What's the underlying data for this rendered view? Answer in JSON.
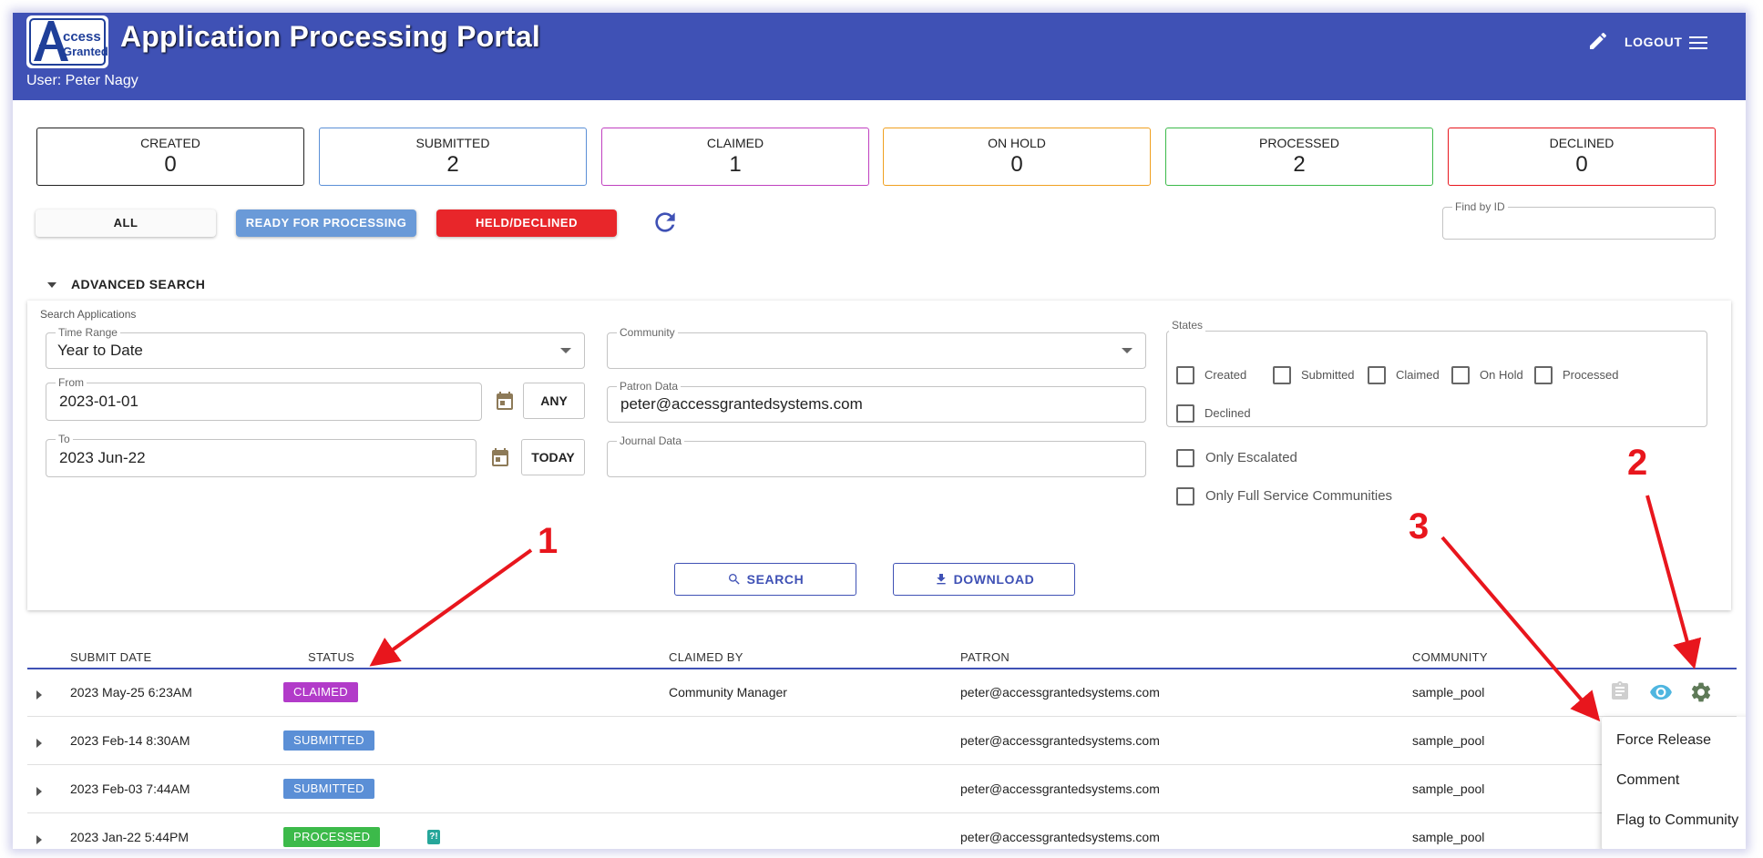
{
  "header": {
    "logo_line1": "ccess",
    "logo_line2": "Granted",
    "title": "Application Processing Portal",
    "user": "User: Peter Nagy",
    "logout_label": "LOGOUT",
    "bar_color": "#3f51b5"
  },
  "status_counts": [
    {
      "label": "CREATED",
      "value": "0",
      "color": "#222222"
    },
    {
      "label": "SUBMITTED",
      "value": "2",
      "color": "#5b8fd6"
    },
    {
      "label": "CLAIMED",
      "value": "1",
      "color": "#c040c0"
    },
    {
      "label": "ON HOLD",
      "value": "0",
      "color": "#f0a020"
    },
    {
      "label": "PROCESSED",
      "value": "2",
      "color": "#3cba4a"
    },
    {
      "label": "DECLINED",
      "value": "0",
      "color": "#e8161d"
    }
  ],
  "filters": {
    "all_label": "ALL",
    "ready_label": "READY FOR PROCESSING",
    "held_label": "HELD/DECLINED",
    "find_label": "Find by ID",
    "find_value": ""
  },
  "advanced": {
    "toggle_label": "ADVANCED SEARCH",
    "panel_title": "Search Applications",
    "time_range_label": "Time Range",
    "time_range_value": "Year to Date",
    "from_label": "From",
    "from_value": "2023-01-01",
    "any_label": "ANY",
    "to_label": "To",
    "to_value": "2023 Jun-22",
    "today_label": "TODAY",
    "community_label": "Community",
    "community_value": "",
    "patron_label": "Patron Data",
    "patron_value": "peter@accessgrantedsystems.com",
    "journal_label": "Journal Data",
    "journal_value": "",
    "states_label": "States",
    "states": [
      "Created",
      "Submitted",
      "Claimed",
      "On Hold",
      "Processed",
      "Declined"
    ],
    "only_escalated": "Only Escalated",
    "only_full_service": "Only Full Service Communities",
    "search_label": "SEARCH",
    "download_label": "DOWNLOAD"
  },
  "table": {
    "columns": [
      "SUBMIT DATE",
      "STATUS",
      "CLAIMED BY",
      "PATRON",
      "COMMUNITY"
    ],
    "rows": [
      {
        "date": "2023 May-25 6:23AM",
        "status": "CLAIMED",
        "status_color": "#b23bc9",
        "claimed_by": "Community Manager",
        "patron": "peter@accessgrantedsystems.com",
        "community": "sample_pool"
      },
      {
        "date": "2023 Feb-14 8:30AM",
        "status": "SUBMITTED",
        "status_color": "#5b8fd6",
        "claimed_by": "",
        "patron": "peter@accessgrantedsystems.com",
        "community": "sample_pool"
      },
      {
        "date": "2023 Feb-03 7:44AM",
        "status": "SUBMITTED",
        "status_color": "#5b8fd6",
        "claimed_by": "",
        "patron": "peter@accessgrantedsystems.com",
        "community": "sample_pool"
      },
      {
        "date": "2023 Jan-22 5:44PM",
        "status": "PROCESSED",
        "status_color": "#3cba4a",
        "claimed_by": "",
        "patron": "peter@accessgrantedsystems.com",
        "community": "sample_pool",
        "help": "?!"
      }
    ]
  },
  "context_menu": {
    "items": [
      "Force Release",
      "Comment",
      "Flag to Community"
    ]
  },
  "annotations": [
    "1",
    "2",
    "3"
  ]
}
